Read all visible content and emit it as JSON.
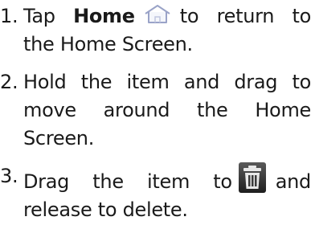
{
  "steps": [
    {
      "number": "1.",
      "before": "Tap ",
      "bold": "Home",
      "icon": "home-icon",
      "after": "to return to the Home Screen."
    },
    {
      "number": "2.",
      "text": "Hold the item and drag to move around the Home Screen."
    },
    {
      "number": "3.",
      "before": "Drag the item to",
      "icon": "trash-icon",
      "after": "and release to delete."
    }
  ],
  "colors": {
    "text": "#1a1a1a",
    "home_icon_stroke": "#9aa3c8",
    "trash_icon": "#333333"
  }
}
